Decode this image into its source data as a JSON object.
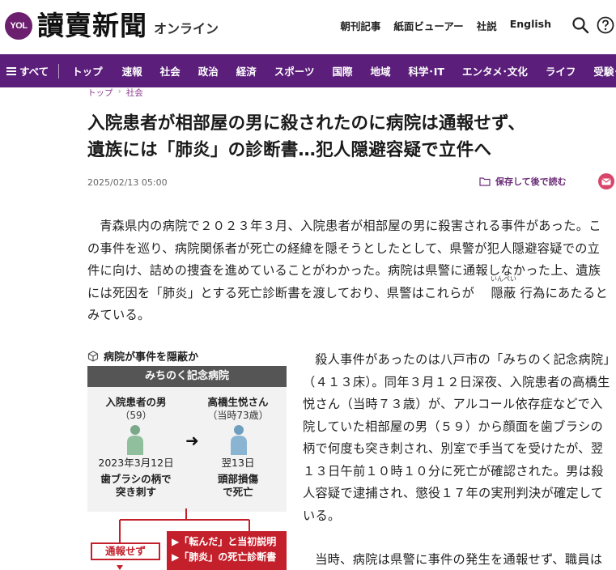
{
  "header": {
    "logo_badge": "YOL",
    "logo_name": "讀賣新聞",
    "logo_suffix": "オンライン",
    "util_links": [
      "朝刊記事",
      "紙面ビューアー",
      "社説",
      "English"
    ],
    "search_icon": "search-icon",
    "help_icon": "help-icon"
  },
  "nav": {
    "all_label": "すべて",
    "items": [
      "トップ",
      "速報",
      "社会",
      "政治",
      "経済",
      "スポーツ",
      "国際",
      "地域",
      "科学･IT",
      "エンタメ･文化",
      "ライフ",
      "受験･就活"
    ],
    "bg_color": "#5b1e7a"
  },
  "breadcrumb": [
    "トップ",
    "社会"
  ],
  "article": {
    "headline_line1": "入院患者が相部屋の男に殺されたのに病院は通報せず、",
    "headline_line2": "遺族には「肺炎」の診断書…犯人隠避容疑で立件へ",
    "date": "2025/02/13 05:00",
    "save_label": "保存して後で読む",
    "para1_a": "青森県内の病院で２０２３年３月、入院患者が相部屋の男に殺害される事件があった。この事件を巡り、病院関係者が死亡の経緯を隠そうとしたとして、県警が犯人隠避容疑での立件に向け、詰めの捜査を進めていることがわかった。病院は県警に通報しなかった上、遺族には死因を「肺炎」とする死亡診断書を渡しており、県警はこれらが",
    "para1_ruby_base": "隠蔽",
    "para1_ruby_text": "いんぺい",
    "para1_b": "行為にあたるとみている。",
    "para2": "殺人事件があったのは八戸市の「みちのく記念病院」（４１３床）。同年３月１２日深夜、入院患者の高橋生悦さん（当時７３歳）が、アルコール依存症などで入院していた相部屋の男（５９）から顔面を歯ブラシの柄で何度も突き刺され、別室で手当てを受けたが、翌１３日午前１０時１０分に死亡が確認された。男は殺人容疑で逮捕され、懲役１７年の実刑判決が確定している。",
    "para3": "当時、病院は県警に事件の発生を通報せず、職員は"
  },
  "figure": {
    "title": "病院が事件を隠蔽か",
    "header": "みちのく記念病院",
    "left_label": "入院患者の男",
    "left_sub": "（59）",
    "left_date": "2023年3月12日",
    "left_desc": [
      "歯ブラシの柄で",
      "突き刺す"
    ],
    "right_label": "高橋生悦さん",
    "right_sub": "（当時73歳）",
    "right_date": "翌13日",
    "right_desc": [
      "頭部損傷",
      "で死亡"
    ],
    "not_reported": "通報せず",
    "red_items": [
      "▶「転んだ」と当初説明",
      "▶「肺炎」の死亡診断書"
    ],
    "accent_red": "#c4202b"
  }
}
